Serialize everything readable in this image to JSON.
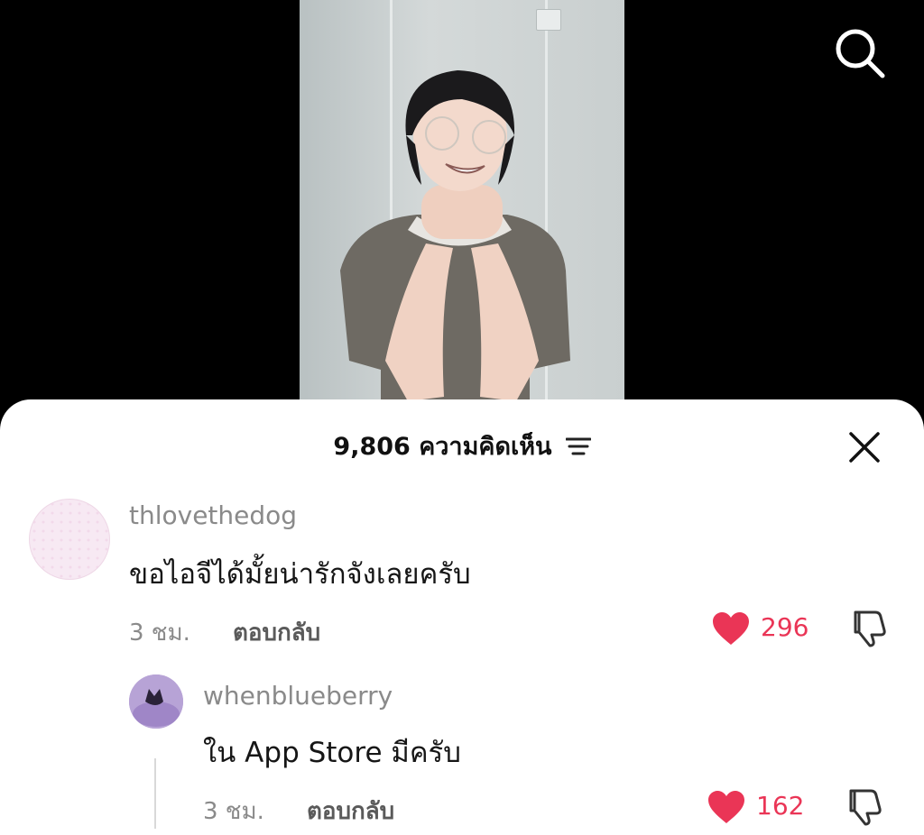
{
  "header": {
    "count": "9,806 ความคิดเห็น"
  },
  "comments": [
    {
      "username": "thlovethedog",
      "text": "ขอไอจีได้มั้ยน่ารักจังเลยครับ",
      "time": "3 ชม.",
      "reply_label": "ตอบกลับ",
      "likes": "296"
    },
    {
      "username": "whenblueberry",
      "text": "ใน App Store มีครับ",
      "time": "3 ชม.",
      "reply_label": "ตอบกลับ",
      "likes": "162"
    }
  ],
  "icons": {
    "search": "search-icon",
    "sort": "sort-icon",
    "close": "close-icon",
    "heart": "heart-icon",
    "dislike": "thumbs-down-icon"
  },
  "colors": {
    "like": "#ea3556",
    "background": "#000000",
    "sheet": "#ffffff"
  }
}
